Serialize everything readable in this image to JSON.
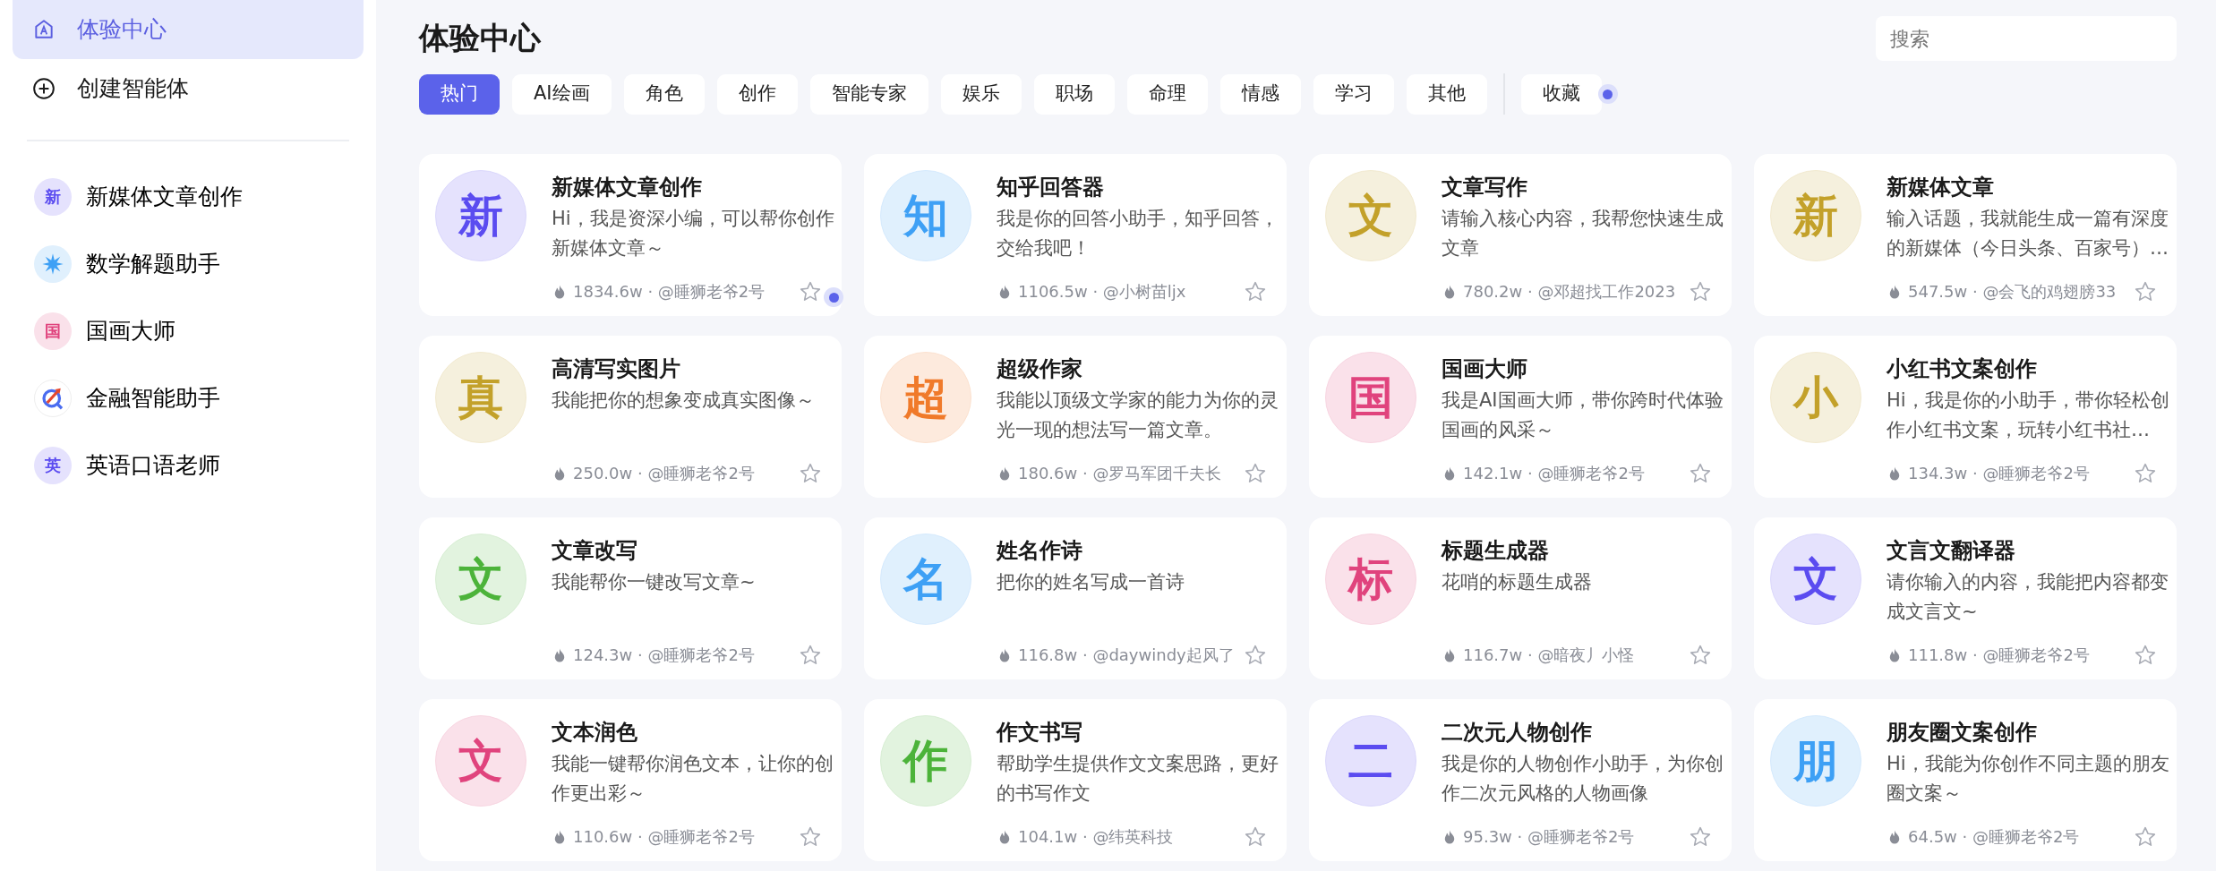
{
  "sidebar": {
    "nav": [
      {
        "label": "体验中心",
        "kind": "home",
        "selected": true
      },
      {
        "label": "创建智能体",
        "kind": "create",
        "selected": false
      }
    ],
    "recent": [
      {
        "glyph": "新",
        "kind": "text",
        "color": "#5b4cf0",
        "label": "新媒体文章创作"
      },
      {
        "kind": "burst",
        "color": "#3ea0f5",
        "label": "数学解题助手"
      },
      {
        "glyph": "国",
        "kind": "text",
        "color": "#e0437d",
        "label": "国画大师"
      },
      {
        "kind": "logo",
        "color": "#4a6cf0",
        "label": "金融智能助手"
      },
      {
        "glyph": "英",
        "kind": "text",
        "color": "#5b4cf0",
        "label": "英语口语老师"
      }
    ]
  },
  "header": {
    "title": "体验中心",
    "search": {
      "placeholder": "搜索"
    }
  },
  "tabs": [
    {
      "label": "热门",
      "selected": true
    },
    {
      "label": "AI绘画",
      "selected": false
    },
    {
      "label": "角色",
      "selected": false
    },
    {
      "label": "创作",
      "selected": false
    },
    {
      "label": "智能专家",
      "selected": false
    },
    {
      "label": "娱乐",
      "selected": false
    },
    {
      "label": "职场",
      "selected": false
    },
    {
      "label": "命理",
      "selected": false
    },
    {
      "label": "情感",
      "selected": false
    },
    {
      "label": "学习",
      "selected": false
    },
    {
      "label": "其他",
      "selected": false
    }
  ],
  "favorites_tab": {
    "label": "收藏",
    "selected": false
  },
  "cards": [
    {
      "glyph": "新",
      "color": "#5b4cf0",
      "title": "新媒体文章创作",
      "desc": "Hi，我是资深小编，可以帮你创作新媒体文章～",
      "meta": "1834.6w · @睡狮老爷2号",
      "starred": false
    },
    {
      "glyph": "知",
      "color": "#3ea0f5",
      "title": "知乎回答器",
      "desc": "我是你的回答小助手，知乎回答，交给我吧！",
      "meta": "1106.5w · @小树苗ljx",
      "starred": false
    },
    {
      "glyph": "文",
      "color": "#c3a12a",
      "title": "文章写作",
      "desc": "请输入核心内容，我帮您快速生成文章",
      "meta": "780.2w · @邓超找工作2023",
      "starred": false
    },
    {
      "glyph": "新",
      "color": "#c3a12a",
      "title": "新媒体文章",
      "desc": "输入话题，我就能生成一篇有深度的新媒体（今日头条、百家号）…",
      "meta": "547.5w · @会飞的鸡翅膀33",
      "starred": false
    },
    {
      "glyph": "真",
      "color": "#c3a12a",
      "title": "高清写实图片",
      "desc": "我能把你的想象变成真实图像～",
      "meta": "250.0w · @睡狮老爷2号",
      "starred": false
    },
    {
      "glyph": "超",
      "color": "#f07a2a",
      "title": "超级作家",
      "desc": "我能以顶级文学家的能力为你的灵光一现的想法写一篇文章。",
      "meta": "180.6w · @罗马军团千夫长",
      "starred": false
    },
    {
      "glyph": "国",
      "color": "#e0437d",
      "title": "国画大师",
      "desc": "我是AI国画大师，带你跨时代体验国画的风采～",
      "meta": "142.1w · @睡狮老爷2号",
      "starred": false
    },
    {
      "glyph": "小",
      "color": "#c3a12a",
      "title": "小红书文案创作",
      "desc": "Hi，我是你的小助手，带你轻松创作小红书文案，玩转小红书社…",
      "meta": "134.3w · @睡狮老爷2号",
      "starred": false
    },
    {
      "glyph": "文",
      "color": "#4cb33a",
      "title": "文章改写",
      "desc": "我能帮你一键改写文章~",
      "meta": "124.3w · @睡狮老爷2号",
      "starred": false
    },
    {
      "glyph": "名",
      "color": "#3ea0f5",
      "title": "姓名作诗",
      "desc": "把你的姓名写成一首诗",
      "meta": "116.8w · @daywindy起风了",
      "starred": false
    },
    {
      "glyph": "标",
      "color": "#e0437d",
      "title": "标题生成器",
      "desc": "花哨的标题生成器",
      "meta": "116.7w · @暗夜丿小怪",
      "starred": false
    },
    {
      "glyph": "文",
      "color": "#5b4cf0",
      "title": "文言文翻译器",
      "desc": "请你输入的内容，我能把内容都变成文言文~",
      "meta": "111.8w · @睡狮老爷2号",
      "starred": false
    },
    {
      "glyph": "文",
      "color": "#e0437d",
      "title": "文本润色",
      "desc": "我能一键帮你润色文本，让你的创作更出彩～",
      "meta": "110.6w · @睡狮老爷2号",
      "starred": false
    },
    {
      "glyph": "作",
      "color": "#4cb33a",
      "title": "作文书写",
      "desc": "帮助学生提供作文文案思路，更好的书写作文",
      "meta": "104.1w · @纬英科技",
      "starred": false
    },
    {
      "glyph": "二",
      "color": "#5b4cf0",
      "title": "二次元人物创作",
      "desc": "我是你的人物创作小助手，为你创作二次元风格的人物画像",
      "meta": "95.3w · @睡狮老爷2号",
      "starred": false
    },
    {
      "glyph": "朋",
      "color": "#3ea0f5",
      "title": "朋友圈文案创作",
      "desc": "Hi，我能为你创作不同主题的朋友圈文案～",
      "meta": "64.5w · @睡狮老爷2号",
      "starred": false
    }
  ]
}
